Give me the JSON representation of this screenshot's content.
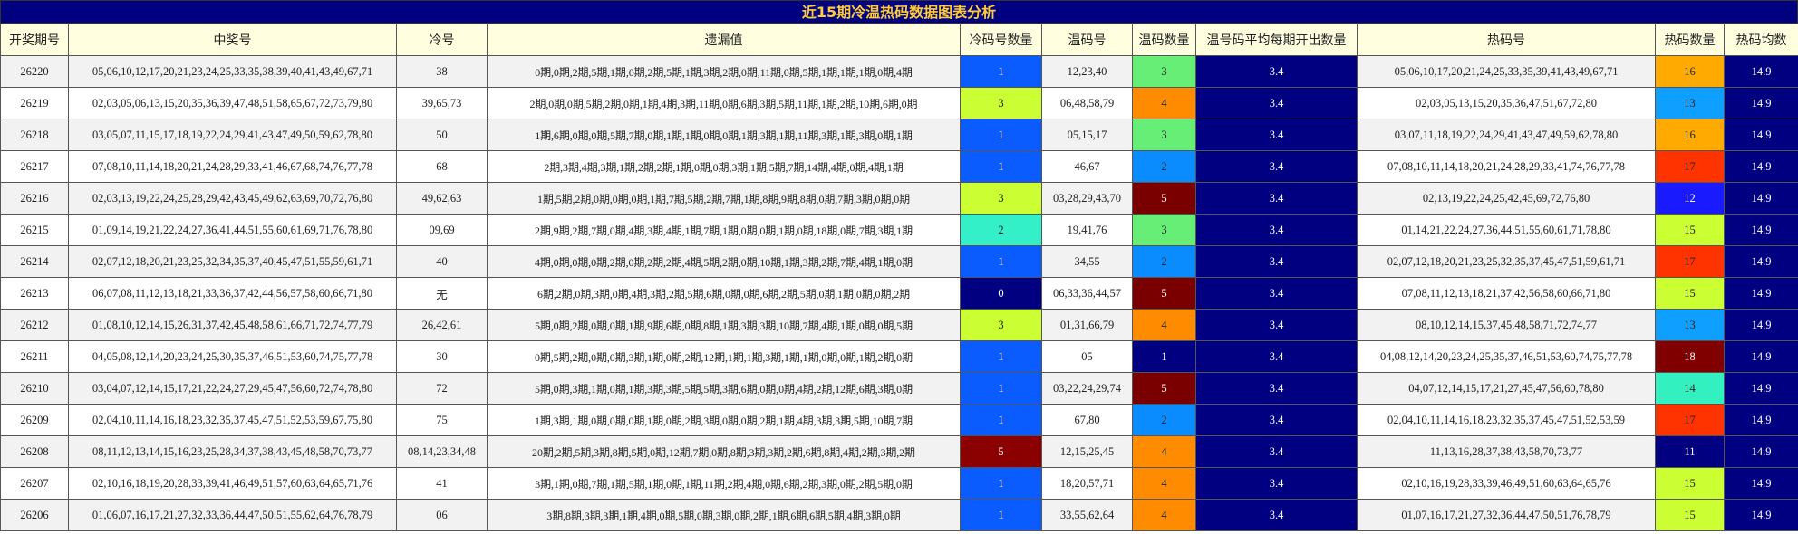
{
  "title": "近15期冷温热码数据图表分析",
  "headers": [
    "开奖期号",
    "中奖号",
    "冷号",
    "遗漏值",
    "冷码号数量",
    "温码号",
    "温码数量",
    "温号码平均每期开出数量",
    "热码号",
    "热码数量",
    "热码均数"
  ],
  "colors": {
    "title_bg": "#000080",
    "title_fg": "#ffcc33",
    "header_bg": "#ffffe0",
    "avg_bg": "#000080",
    "palette": {
      "0": "#000080",
      "1": "#0a5cff",
      "2": "#33f0c8",
      "3": "#ccff33",
      "5": "#8b0000",
      "w1": "#000080",
      "w2": "#0a8cff",
      "w3": "#66ee77",
      "w4": "#ff8c00",
      "w5": "#7a0000",
      "h11": "#000080",
      "h12": "#1a1aff",
      "h13": "#0fa0ff",
      "h14": "#33f0c0",
      "h15": "#ccff33",
      "h16": "#ffaa00",
      "h17": "#ff3300",
      "h18": "#800000"
    }
  },
  "rows": [
    {
      "issue": "26220",
      "winning": "05,06,10,12,17,20,21,23,24,25,33,35,38,39,40,41,43,49,67,71",
      "cold": "38",
      "missing": "0期,0期,2期,5期,1期,0期,2期,5期,1期,3期,2期,0期,11期,0期,5期,1期,1期,1期,0期,4期",
      "cold_count": "1",
      "warm": "12,23,40",
      "warm_count": "3",
      "warm_avg": "3.4",
      "hot": "05,06,10,17,20,21,24,25,33,35,39,41,43,49,67,71",
      "hot_count": "16",
      "hot_avg": "14.9"
    },
    {
      "issue": "26219",
      "winning": "02,03,05,06,13,15,20,35,36,39,47,48,51,58,65,67,72,73,79,80",
      "cold": "39,65,73",
      "missing": "2期,0期,0期,5期,2期,0期,1期,4期,3期,11期,0期,6期,3期,5期,11期,1期,2期,10期,6期,0期",
      "cold_count": "3",
      "warm": "06,48,58,79",
      "warm_count": "4",
      "warm_avg": "3.4",
      "hot": "02,03,05,13,15,20,35,36,47,51,67,72,80",
      "hot_count": "13",
      "hot_avg": "14.9"
    },
    {
      "issue": "26218",
      "winning": "03,05,07,11,15,17,18,19,22,24,29,41,43,47,49,50,59,62,78,80",
      "cold": "50",
      "missing": "1期,6期,0期,0期,5期,7期,0期,1期,1期,0期,0期,1期,3期,1期,11期,3期,1期,3期,0期,1期",
      "cold_count": "1",
      "warm": "05,15,17",
      "warm_count": "3",
      "warm_avg": "3.4",
      "hot": "03,07,11,18,19,22,24,29,41,43,47,49,59,62,78,80",
      "hot_count": "16",
      "hot_avg": "14.9"
    },
    {
      "issue": "26217",
      "winning": "07,08,10,11,14,18,20,21,24,28,29,33,41,46,67,68,74,76,77,78",
      "cold": "68",
      "missing": "2期,3期,4期,3期,1期,2期,2期,1期,0期,0期,3期,1期,5期,7期,14期,4期,0期,4期,1期",
      "cold_count": "1",
      "warm": "46,67",
      "warm_count": "2",
      "warm_avg": "3.4",
      "hot": "07,08,10,11,14,18,20,21,24,28,29,33,41,74,76,77,78",
      "hot_count": "17",
      "hot_avg": "14.9"
    },
    {
      "issue": "26216",
      "winning": "02,03,13,19,22,24,25,28,29,42,43,45,49,62,63,69,70,72,76,80",
      "cold": "49,62,63",
      "missing": "1期,5期,2期,0期,0期,0期,1期,7期,5期,2期,7期,1期,8期,9期,8期,0期,7期,3期,0期,0期",
      "cold_count": "3",
      "warm": "03,28,29,43,70",
      "warm_count": "5",
      "warm_avg": "3.4",
      "hot": "02,13,19,22,24,25,42,45,69,72,76,80",
      "hot_count": "12",
      "hot_avg": "14.9"
    },
    {
      "issue": "26215",
      "winning": "01,09,14,19,21,22,24,27,36,41,44,51,55,60,61,69,71,76,78,80",
      "cold": "09,69",
      "missing": "2期,9期,2期,7期,0期,4期,3期,4期,1期,7期,1期,0期,0期,1期,0期,18期,0期,7期,3期,1期",
      "cold_count": "2",
      "warm": "19,41,76",
      "warm_count": "3",
      "warm_avg": "3.4",
      "hot": "01,14,21,22,24,27,36,44,51,55,60,61,71,78,80",
      "hot_count": "15",
      "hot_avg": "14.9"
    },
    {
      "issue": "26214",
      "winning": "02,07,12,18,20,21,23,25,32,34,35,37,40,45,47,51,55,59,61,71",
      "cold": "40",
      "missing": "4期,0期,0期,0期,2期,0期,2期,2期,4期,5期,2期,0期,10期,1期,3期,2期,7期,4期,1期,0期",
      "cold_count": "1",
      "warm": "34,55",
      "warm_count": "2",
      "warm_avg": "3.4",
      "hot": "02,07,12,18,20,21,23,25,32,35,37,45,47,51,59,61,71",
      "hot_count": "17",
      "hot_avg": "14.9"
    },
    {
      "issue": "26213",
      "winning": "06,07,08,11,12,13,18,21,33,36,37,42,44,56,57,58,60,66,71,80",
      "cold": "无",
      "missing": "6期,2期,0期,3期,0期,4期,3期,2期,5期,6期,0期,0期,6期,2期,5期,0期,1期,0期,0期,2期",
      "cold_count": "0",
      "warm": "06,33,36,44,57",
      "warm_count": "5",
      "warm_avg": "3.4",
      "hot": "07,08,11,12,13,18,21,37,42,56,58,60,66,71,80",
      "hot_count": "15",
      "hot_avg": "14.9"
    },
    {
      "issue": "26212",
      "winning": "01,08,10,12,14,15,26,31,37,42,45,48,58,61,66,71,72,74,77,79",
      "cold": "26,42,61",
      "missing": "5期,0期,2期,0期,0期,1期,9期,6期,0期,8期,1期,3期,3期,10期,7期,4期,1期,0期,0期,5期",
      "cold_count": "3",
      "warm": "01,31,66,79",
      "warm_count": "4",
      "warm_avg": "3.4",
      "hot": "08,10,12,14,15,37,45,48,58,71,72,74,77",
      "hot_count": "13",
      "hot_avg": "14.9"
    },
    {
      "issue": "26211",
      "winning": "04,05,08,12,14,20,23,24,25,30,35,37,46,51,53,60,74,75,77,78",
      "cold": "30",
      "missing": "0期,5期,2期,0期,0期,3期,1期,0期,2期,12期,1期,1期,3期,1期,1期,0期,0期,1期,2期,0期",
      "cold_count": "1",
      "warm": "05",
      "warm_count": "1",
      "warm_avg": "3.4",
      "hot": "04,08,12,14,20,23,24,25,35,37,46,51,53,60,74,75,77,78",
      "hot_count": "18",
      "hot_avg": "14.9"
    },
    {
      "issue": "26210",
      "winning": "03,04,07,12,14,15,17,21,22,24,27,29,45,47,56,60,72,74,78,80",
      "cold": "72",
      "missing": "5期,0期,3期,1期,0期,1期,3期,3期,5期,5期,3期,6期,0期,0期,4期,2期,12期,6期,3期,0期",
      "cold_count": "1",
      "warm": "03,22,24,29,74",
      "warm_count": "5",
      "warm_avg": "3.4",
      "hot": "04,07,12,14,15,17,21,27,45,47,56,60,78,80",
      "hot_count": "14",
      "hot_avg": "14.9"
    },
    {
      "issue": "26209",
      "winning": "02,04,10,11,14,16,18,23,32,35,37,45,47,51,52,53,59,67,75,80",
      "cold": "75",
      "missing": "1期,3期,1期,0期,0期,0期,1期,0期,2期,3期,0期,0期,2期,1期,4期,3期,3期,5期,10期,7期",
      "cold_count": "1",
      "warm": "67,80",
      "warm_count": "2",
      "warm_avg": "3.4",
      "hot": "02,04,10,11,14,16,18,23,32,35,37,45,47,51,52,53,59",
      "hot_count": "17",
      "hot_avg": "14.9"
    },
    {
      "issue": "26208",
      "winning": "08,11,12,13,14,15,16,23,25,28,34,37,38,43,45,48,58,70,73,77",
      "cold": "08,14,23,34,48",
      "missing": "20期,2期,5期,3期,8期,5期,0期,12期,7期,0期,8期,3期,3期,2期,6期,8期,4期,2期,3期,2期",
      "cold_count": "5",
      "warm": "12,15,25,45",
      "warm_count": "4",
      "warm_avg": "3.4",
      "hot": "11,13,16,28,37,38,43,58,70,73,77",
      "hot_count": "11",
      "hot_avg": "14.9"
    },
    {
      "issue": "26207",
      "winning": "02,10,16,18,19,20,28,33,39,41,46,49,51,57,60,63,64,65,71,76",
      "cold": "41",
      "missing": "3期,1期,0期,7期,1期,5期,1期,0期,1期,11期,2期,4期,0期,6期,2期,3期,0期,2期,5期,0期",
      "cold_count": "1",
      "warm": "18,20,57,71",
      "warm_count": "4",
      "warm_avg": "3.4",
      "hot": "02,10,16,19,28,33,39,46,49,51,60,63,64,65,76",
      "hot_count": "15",
      "hot_avg": "14.9"
    },
    {
      "issue": "26206",
      "winning": "01,06,07,16,17,21,27,32,33,36,44,47,50,51,55,62,64,76,78,79",
      "cold": "06",
      "missing": "3期,8期,3期,3期,1期,4期,0期,5期,0期,3期,0期,2期,1期,6期,6期,5期,4期,3期,0期",
      "cold_count": "1",
      "warm": "33,55,62,64",
      "warm_count": "4",
      "warm_avg": "3.4",
      "hot": "01,07,16,17,21,27,32,36,44,47,50,51,76,78,79",
      "hot_count": "15",
      "hot_avg": "14.9"
    }
  ]
}
